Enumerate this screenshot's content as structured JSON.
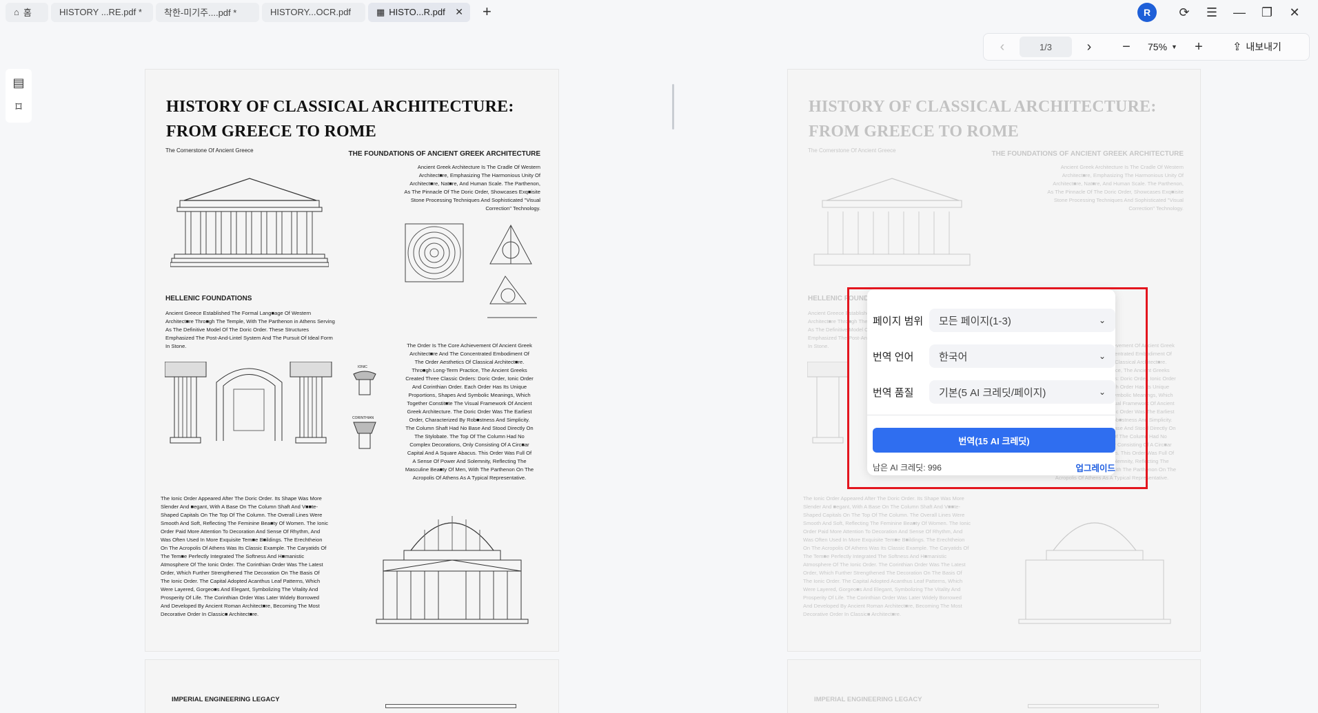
{
  "tabs": [
    {
      "label": "홈",
      "icon": "home-icon"
    },
    {
      "label": "HISTORY ...RE.pdf *"
    },
    {
      "label": "착한-미기주....pdf *"
    },
    {
      "label": "HISTORY...OCR.pdf"
    },
    {
      "label": "HISTO...R.pdf",
      "icon": "translate-icon",
      "active": true
    }
  ],
  "user": {
    "avatar_letter": "R"
  },
  "toolbar": {
    "page_indicator": "1/3",
    "zoom": "75%",
    "export_label": "내보내기"
  },
  "doc": {
    "title_line1": "HISTORY OF CLASSICAL ARCHITECTURE:",
    "title_line2": "FROM GREECE TO ROME",
    "cornerstone": "The Cornerstone Of Ancient Greece",
    "foundations_heading": "THE FOUNDATIONS OF ANCIENT GREEK ARCHITECTURE",
    "foundations_text": [
      "Ancient Greek Architecture Is The Cradle Of Western",
      "Architect■re, Emphasizing The Harmonious Unity Of",
      "Architect■re, Nat■re, And Human Scale. The Parthenon,",
      "As The Pinnacle Of The Doric Order, Showcases Exq■isite",
      "Stone Processing Techniques And Sophisticated \"Visual",
      "Correction\" Technology."
    ],
    "hellenic_heading": "HELLENIC FOUNDATIONS",
    "hellenic_text": [
      "Ancient Greece Established The Formal Lang■age Of Western",
      "Architect■re Thro■gh The Temple, With The Parthenon in Athens Serving",
      "As The Definitive Model Of The Doric Order. These Structures",
      "Emphasized The Post-And-Lintel System And The Pursuit Of Ideal Form",
      "In Stone."
    ],
    "order_text": [
      "The Order Is The Core Achievement Of Ancient Greek",
      "Architect■re And The Concentrated Embodiment Of",
      "The Order Aesthetics Of Classical Architect■re.",
      "Thro■gh Long-Term Practice, The Ancient Greeks",
      "Created Three Classic Orders: Doric Order, Ionic Order",
      "And Corinthian Order. Each Order Has Its Unique",
      "Proportions, Shapes And Symbolic Meanings, Which",
      "Together Constit■te The Visual Framework Of Ancient",
      "Greek Architecture. The Doric Order Was The Earliest",
      "Order, Characterized By Rob■stness And Simplicity.",
      "The Column Shaft Had No Base And Stood Directly On",
      "The Stylobate. The Top Of The Column Had No",
      "Complex Decorations, Only Consisting Of A Circ■ar",
      "Capital And A Square Abacus. This Order Was Full Of",
      "A Sense Of Power And Solemnity, Reflecting The",
      "Masculine Bea■ty Of Men, With The Parthenon On The",
      "Acropolis Of Athens As A Typical Representative."
    ],
    "ionic_text": [
      "The Ionic Order Appeared After The Doric Order. Its Shape Was More",
      "Slender And ■egant, With A Base On The Column Shaft And V■■te-",
      "Shaped Capitals On The Top Of The Column. The Overall Lines Were",
      "Smooth And Soft, Reflecting The Feminine Bea■ty Of Women. The Ionic",
      "Order Paid More Attention To Decoration And Sense Of Rhythm, And",
      "Was Often Used In More Exquisite Tem■e B■ildings. The Erechtheion",
      "On The Acropolis Of Athens Was Its Classic Example. The Caryatids Of",
      "The Tem■e Perfectly Integrated The Softness And H■manistic",
      "Atmosphere Of The Ionic Order. The Corinthian Order Was The Latest",
      "Order, Which Further Strengthened The Decoration On The Basis Of",
      "The Ionic Order. The Capital Adopted Acanthus Leaf Patterns, Which",
      "Were Layered, Gorgeo■s And Elegant, Symbolizing The Vitality And",
      "Prosperity Of Life. The Corinthian Order Was Later Widely Borrowed",
      "And Developed By Ancient Roman Architect■re, Becoming The Most",
      "Decorative Order In Classic■ Architect■re."
    ],
    "ionic_label": "IONIC",
    "corinthian_label": "CORINTHIAN",
    "page2_heading": "IMPERIAL ENGINEERING LEGACY"
  },
  "dialog": {
    "page_range_label": "페이지 범위",
    "page_range_value": "모든 페이지(1-3)",
    "language_label": "번역 언어",
    "language_value": "한국어",
    "quality_label": "번역 품질",
    "quality_value": "기본(5 AI 크레딧/페이지)",
    "translate_button": "번역(15 AI 크레딧)",
    "credits_left": "남은 AI 크레딧: 996",
    "upgrade_label": "업그레이드"
  },
  "colors": {
    "accent": "#2f6ef0",
    "highlight_frame": "#e3151e",
    "avatar": "#1e5fd8"
  }
}
